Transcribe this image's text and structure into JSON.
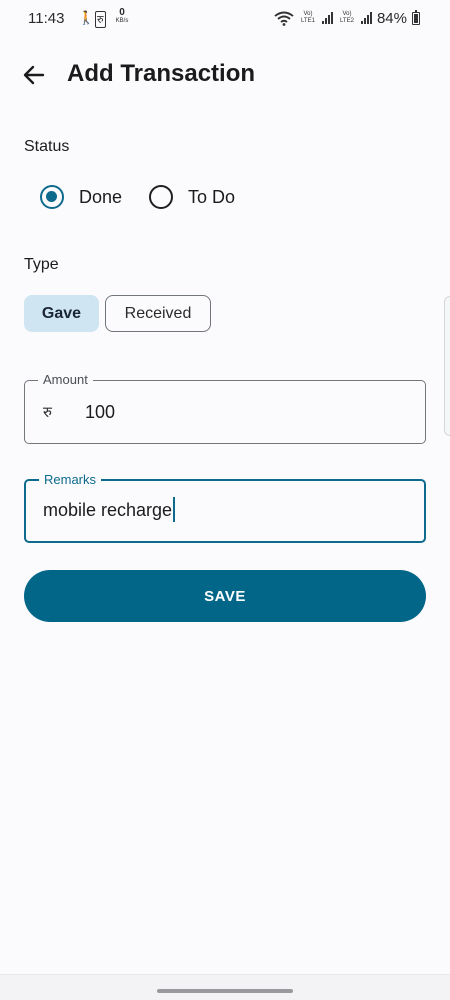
{
  "status_bar": {
    "time": "11:43",
    "glyph_1": "🚶",
    "glyph_2": "रु",
    "speed_value": "0",
    "speed_unit": "KB/s",
    "sim1": "Vo) LTE1",
    "sim2": "Vo) LTE2",
    "battery": "84%",
    "icons": [
      "notification-icon",
      "rupee-notification-icon",
      "wifi-icon",
      "signal-icon",
      "signal-icon",
      "battery-icon"
    ]
  },
  "app_bar": {
    "back_icon": "arrow-left-icon",
    "title": "Add Transaction"
  },
  "status_section": {
    "label": "Status",
    "options": [
      {
        "label": "Done",
        "selected": true
      },
      {
        "label": "To Do",
        "selected": false
      }
    ]
  },
  "type_section": {
    "label": "Type",
    "options": [
      {
        "label": "Gave",
        "selected": true
      },
      {
        "label": "Received",
        "selected": false
      }
    ]
  },
  "amount_field": {
    "label": "Amount",
    "prefix": "रु",
    "value": "100"
  },
  "remarks_field": {
    "label": "Remarks",
    "value": "mobile recharge"
  },
  "save_button": {
    "label": "SAVE"
  },
  "colors": {
    "accent": "#026689",
    "selected_chip_bg": "#cfe5f2",
    "background": "#fbfbfd"
  }
}
